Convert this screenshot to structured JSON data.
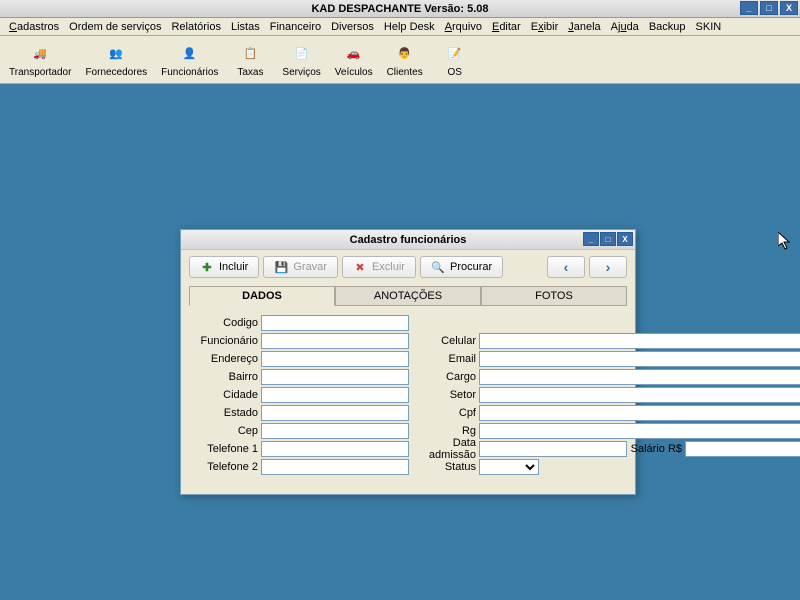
{
  "app": {
    "title": "KAD DESPACHANTE     Versão: 5.08"
  },
  "menu": {
    "items": [
      "Cadastros",
      "Ordem de serviços",
      "Relatórios",
      "Listas",
      "Financeiro",
      "Diversos",
      "Help Desk",
      "Arquivo",
      "Editar",
      "Exibir",
      "Janela",
      "Ajuda",
      "Backup",
      "SKIN"
    ]
  },
  "toolbar": {
    "items": [
      {
        "label": "Transportador",
        "icon": "🚚"
      },
      {
        "label": "Fornecedores",
        "icon": "👥"
      },
      {
        "label": "Funcionários",
        "icon": "👤"
      },
      {
        "label": "Taxas",
        "icon": "📋"
      },
      {
        "label": "Serviços",
        "icon": "📄"
      },
      {
        "label": "Veículos",
        "icon": "🚗"
      },
      {
        "label": "Clientes",
        "icon": "👨"
      },
      {
        "label": "OS",
        "icon": "📝"
      }
    ]
  },
  "child": {
    "title": "Cadastro funcionários",
    "buttons": {
      "incluir": "Incluir",
      "gravar": "Gravar",
      "excluir": "Excluir",
      "procurar": "Procurar"
    },
    "tabs": {
      "dados": "DADOS",
      "anotacoes": "ANOTAÇÕES",
      "fotos": "FOTOS"
    },
    "fields": {
      "codigo": "Codigo",
      "funcionario": "Funcionário",
      "endereco": "Endereço",
      "bairro": "Bairro",
      "cidade": "Cidade",
      "estado": "Estado",
      "cep": "Cep",
      "telefone1": "Telefone 1",
      "telefone2": "Telefone 2",
      "celular": "Celular",
      "email": "Email",
      "cargo": "Cargo",
      "setor": "Setor",
      "cpf": "Cpf",
      "rg": "Rg",
      "dataadmissao": "Data admissão",
      "salario": "Salário R$",
      "status": "Status"
    }
  }
}
